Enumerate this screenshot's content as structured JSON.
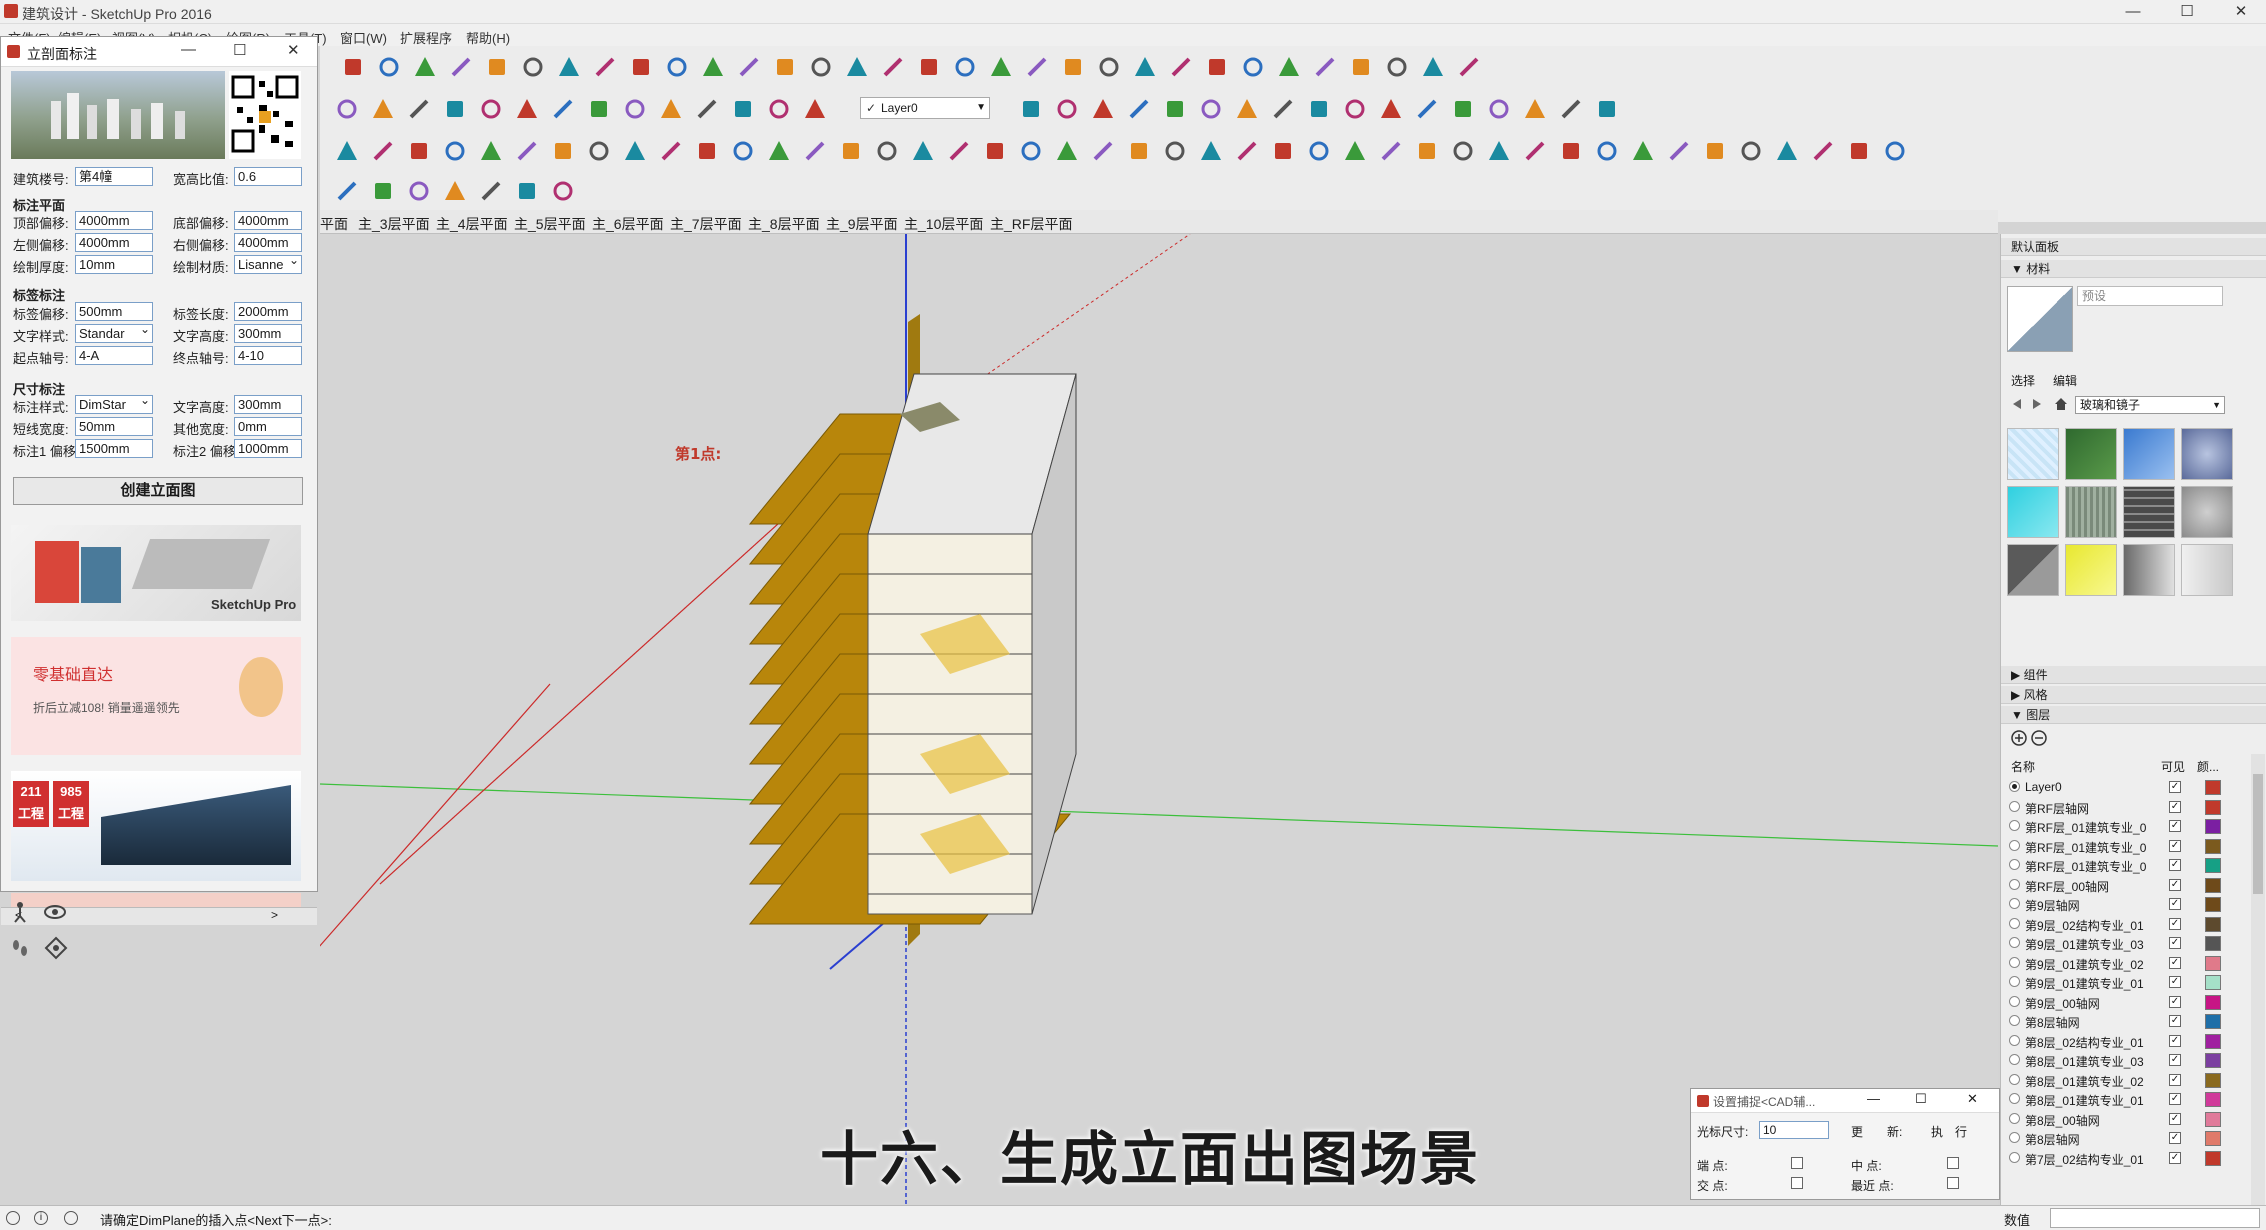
{
  "window": {
    "title": "建筑设计 - SketchUp Pro 2016",
    "min": "—",
    "max": "☐",
    "close": "✕"
  },
  "menu": [
    "文件(F)",
    "编辑(E)",
    "视图(V)",
    "相机(C)",
    "绘图(R)",
    "工具(T)",
    "窗口(W)",
    "扩展程序",
    "帮助(H)"
  ],
  "toolbar": {
    "layer_combo": "Layer0",
    "layer_check": "✓"
  },
  "scene_tabs": [
    "平面",
    "主_3层平面",
    "主_4层平面",
    "主_5层平面",
    "主_6层平面",
    "主_7层平面",
    "主_8层平面",
    "主_9层平面",
    "主_10层平面",
    "主_RF层平面"
  ],
  "left_panel": {
    "title": "立剖面标注",
    "building_floor_label": "建筑楼号:",
    "building_floor_value": "第4幢",
    "ratio_label": "宽高比值:",
    "ratio_value": "0.6",
    "section_plane": "标注平面",
    "top_offset_label": "顶部偏移:",
    "top_offset_value": "4000mm",
    "bottom_offset_label": "底部偏移:",
    "bottom_offset_value": "4000mm",
    "left_offset_label": "左侧偏移:",
    "left_offset_value": "4000mm",
    "right_offset_label": "右侧偏移:",
    "right_offset_value": "4000mm",
    "thickness_label": "绘制厚度:",
    "thickness_value": "10mm",
    "material_label": "绘制材质:",
    "material_value": "Lisanne",
    "section_label": "标签标注",
    "tag_offset_label": "标签偏移:",
    "tag_offset_value": "500mm",
    "tag_length_label": "标签长度:",
    "tag_length_value": "2000mm",
    "text_style_label": "文字样式:",
    "text_style_value": "Standar",
    "text_height_label": "文字高度:",
    "text_height_value": "300mm",
    "start_axis_label": "起点轴号:",
    "start_axis_value": "4-A",
    "end_axis_label": "终点轴号:",
    "end_axis_value": "4-10",
    "section_dim": "尺寸标注",
    "dim_style_label": "标注样式:",
    "dim_style_value": "DimStar",
    "dim_text_height_label": "文字高度:",
    "dim_text_height_value": "300mm",
    "short_width_label": "短线宽度:",
    "short_width_value": "50mm",
    "other_width_label": "其他宽度:",
    "other_width_value": "0mm",
    "dim1_offset_label": "标注1 偏移:",
    "dim1_offset_value": "1500mm",
    "dim2_offset_label": "标注2 偏移:",
    "dim2_offset_value": "1000mm",
    "create_button": "创建立面图",
    "ad1_text": "SketchUp Pro",
    "ad2_title": "零基础直达",
    "ad2_sub": "折后立减108! 销量遥遥领先",
    "ad3_badge1": "211 工程",
    "ad3_badge2": "985 工程"
  },
  "viewport": {
    "point_label": "第1点:"
  },
  "right_panel": {
    "header": "默认面板",
    "materials": "材料",
    "preset": "预设",
    "tab_select": "选择",
    "tab_edit": "编辑",
    "library": "玻璃和镜子",
    "components": "组件",
    "styles": "风格",
    "layers": "图层",
    "col_name": "名称",
    "col_visible": "可见",
    "col_color": "颜...",
    "layer_rows": [
      {
        "name": "Layer0",
        "active": true,
        "color": "#c0392b"
      },
      {
        "name": "第RF层轴网",
        "active": false,
        "color": "#c0392b"
      },
      {
        "name": "第RF层_01建筑专业_0",
        "active": false,
        "color": "#7b1fa2"
      },
      {
        "name": "第RF层_01建筑专业_0",
        "active": false,
        "color": "#7b5a1e"
      },
      {
        "name": "第RF层_01建筑专业_0",
        "active": false,
        "color": "#16a085"
      },
      {
        "name": "第RF层_00轴网",
        "active": false,
        "color": "#6e4a1a"
      },
      {
        "name": "第9层轴网",
        "active": false,
        "color": "#6e4a1a"
      },
      {
        "name": "第9层_02结构专业_01",
        "active": false,
        "color": "#5d4a2e"
      },
      {
        "name": "第9层_01建筑专业_03",
        "active": false,
        "color": "#555555"
      },
      {
        "name": "第9层_01建筑专业_02",
        "active": false,
        "color": "#e07a8a"
      },
      {
        "name": "第9层_01建筑专业_01",
        "active": false,
        "color": "#a5e0c8"
      },
      {
        "name": "第9层_00轴网",
        "active": false,
        "color": "#c71585"
      },
      {
        "name": "第8层轴网",
        "active": false,
        "color": "#1f6fa8"
      },
      {
        "name": "第8层_02结构专业_01",
        "active": false,
        "color": "#a020a0"
      },
      {
        "name": "第8层_01建筑专业_03",
        "active": false,
        "color": "#7b3fa0"
      },
      {
        "name": "第8层_01建筑专业_02",
        "active": false,
        "color": "#8a6a1e"
      },
      {
        "name": "第8层_01建筑专业_01",
        "active": false,
        "color": "#d03a9a"
      },
      {
        "name": "第8层_00轴网",
        "active": false,
        "color": "#e07a9a"
      },
      {
        "name": "第8层轴网",
        "active": false,
        "color": "#e07a6a"
      },
      {
        "name": "第7层_02结构专业_01",
        "active": false,
        "color": "#c0392b"
      }
    ]
  },
  "snap_dialog": {
    "title": "设置捕捉<CAD辅...",
    "cursor_size_label": "光标尺寸:",
    "cursor_size_value": "10",
    "btn_more": "更",
    "btn_new": "新:",
    "btn_exec": "执",
    "btn_row": "行",
    "endpoint": "端 点:",
    "midpoint": "中 点:",
    "intersection": "交 点:",
    "nearest": "最近 点:"
  },
  "caption": "十六、生成立面出图场景",
  "status": {
    "message": "请确定DimPlane的插入点<Next下一点>:",
    "value_label": "数值"
  },
  "colors": {
    "slab": "#b8860b",
    "accent": "#c0392b"
  }
}
